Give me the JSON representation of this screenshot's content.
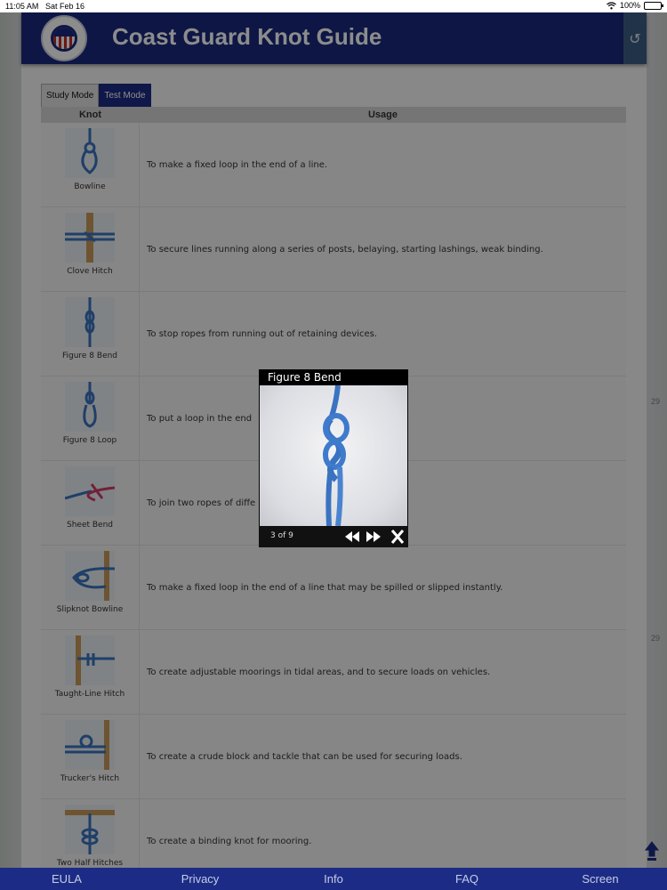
{
  "status_bar": {
    "time": "11:05 AM",
    "date": "Sat Feb 16",
    "battery": "100%"
  },
  "header": {
    "title": "Coast Guard Knot Guide"
  },
  "tabs": [
    {
      "label": "Study Mode",
      "active": true
    },
    {
      "label": "Test Mode",
      "active": false
    }
  ],
  "table": {
    "columns": [
      "Knot",
      "Usage"
    ],
    "rows": [
      {
        "name": "Bowline",
        "usage": "To make a fixed loop in the end of a line."
      },
      {
        "name": "Clove Hitch",
        "usage": "To secure lines running along a series of posts, belaying, starting lashings, weak binding."
      },
      {
        "name": "Figure 8 Bend",
        "usage": "To stop ropes from running out of retaining devices."
      },
      {
        "name": "Figure 8 Loop",
        "usage": "To put a loop in the end"
      },
      {
        "name": "Sheet Bend",
        "usage": "To join two ropes of diffe"
      },
      {
        "name": "Slipknot Bowline",
        "usage": "To make a fixed loop in the end of a line that may be spilled or slipped instantly."
      },
      {
        "name": "Taught-Line Hitch",
        "usage": "To create adjustable moorings in tidal areas, and to secure loads on vehicles."
      },
      {
        "name": "Trucker's Hitch",
        "usage": "To create a crude block and tackle that can be used for securing loads."
      },
      {
        "name": "Two Half Hitches",
        "usage": "To create a binding knot for mooring."
      }
    ]
  },
  "map_labels": [
    "29",
    "29"
  ],
  "popup": {
    "title": "Figure 8 Bend",
    "counter": "3 of 9"
  },
  "bottom_nav": [
    "EULA",
    "Privacy",
    "Info",
    "FAQ",
    "Screen"
  ],
  "colors": {
    "header": "#18297d",
    "rope": "#3a73c0",
    "post": "#c89a5a"
  }
}
